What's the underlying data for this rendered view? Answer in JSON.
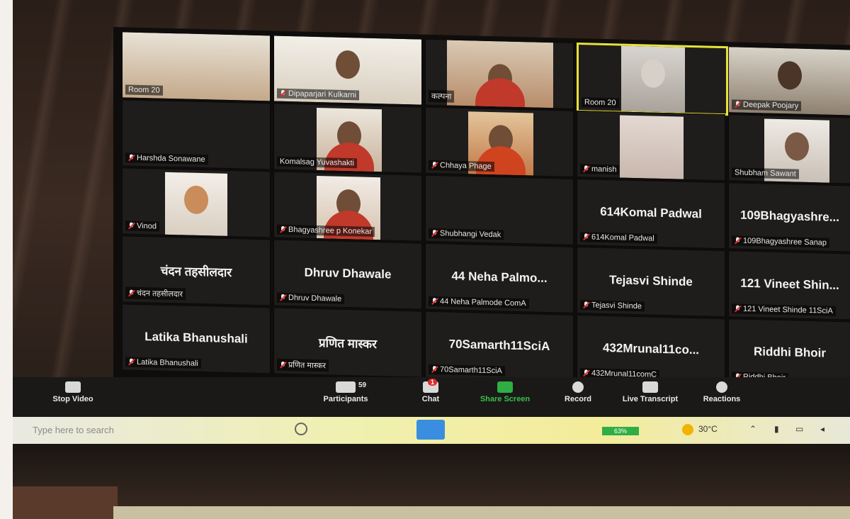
{
  "tiles": [
    {
      "label": "Room 20",
      "big": ""
    },
    {
      "label": "Dipaparjari Kulkarni",
      "big": ""
    },
    {
      "label": "कल्पना",
      "big": ""
    },
    {
      "label": "Room 20",
      "big": ""
    },
    {
      "label": "Deepak Poojary",
      "big": ""
    },
    {
      "label": "Harshda Sonawane",
      "big": ""
    },
    {
      "label": "Komalsag Yuvashakti",
      "big": ""
    },
    {
      "label": "Chhaya Phage",
      "big": ""
    },
    {
      "label": "manish",
      "big": ""
    },
    {
      "label": "Shubham Sawant",
      "big": ""
    },
    {
      "label": "Vinod",
      "big": ""
    },
    {
      "label": "Bhagyashree p Konekar",
      "big": ""
    },
    {
      "label": "Shubhangi Vedak",
      "big": ""
    },
    {
      "label": "614Komal Padwal",
      "big": "614Komal Padwal"
    },
    {
      "label": "109Bhagyashree Sanap",
      "big": "109Bhagyashre..."
    },
    {
      "label": "चंदन तहसीलदार",
      "big": "चंदन तहसीलदार"
    },
    {
      "label": "Dhruv Dhawale",
      "big": "Dhruv Dhawale"
    },
    {
      "label": "44 Neha Palmode ComA",
      "big": "44 Neha Palmo..."
    },
    {
      "label": "Tejasvi Shinde",
      "big": "Tejasvi Shinde"
    },
    {
      "label": "121 Vineet Shinde 11SciA",
      "big": "121 Vineet Shin..."
    },
    {
      "label": "Latika Bhanushali",
      "big": "Latika Bhanushali"
    },
    {
      "label": "प्रणित मास्कर",
      "big": "प्रणित मास्कर"
    },
    {
      "label": "70Samarth11SciA",
      "big": "70Samarth11SciA"
    },
    {
      "label": "432Mrunal11comC",
      "big": "432Mrunal11co..."
    },
    {
      "label": "Riddhi Bhoir",
      "big": "Riddhi Bhoir"
    }
  ],
  "toolbar": {
    "stop_video": "Stop Video",
    "participants": "Participants",
    "participants_count": "59",
    "chat": "Chat",
    "chat_badge": "1",
    "share_screen": "Share Screen",
    "record": "Record",
    "live_transcript": "Live Transcript",
    "reactions": "Reactions"
  },
  "taskbar": {
    "search_placeholder": "Type here to search",
    "battery": "63%",
    "temperature": "30°C"
  },
  "colors": {
    "active_speaker_border": "#e7e23b",
    "share_green": "#2fae44",
    "muted_red": "#e02b2b"
  }
}
